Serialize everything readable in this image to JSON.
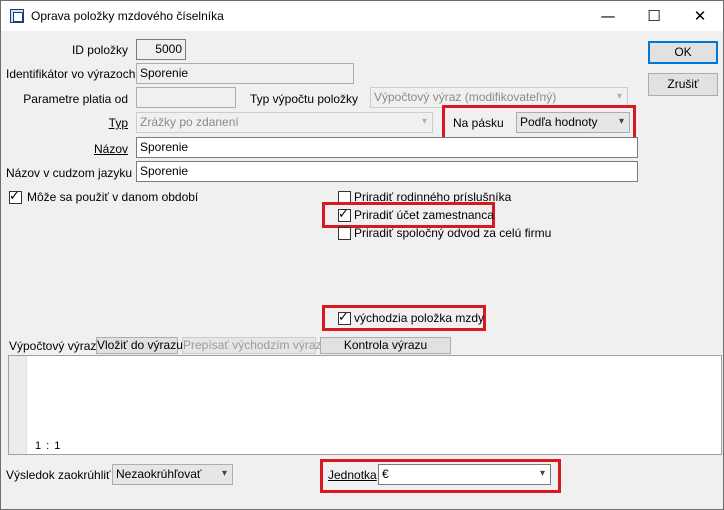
{
  "window": {
    "title": "Oprava položky mzdového číselníka"
  },
  "titlebar": {
    "minimize": "—",
    "maximize": "☐",
    "close": "✕"
  },
  "form": {
    "id_label": "ID položky",
    "id_value": "5000",
    "ident_label": "Identifikátor vo výrazoch",
    "ident_value": "Sporenie",
    "param_label": "Parametre platia od",
    "param_value": "",
    "calc_type_label": "Typ výpočtu položky",
    "calc_type_value": "Výpočtový výraz (modifikovateľný)",
    "type_label": "Typ",
    "type_value": "Zrážky po zdanení",
    "tape_label": "Na pásku",
    "tape_value": "Podľa hodnoty",
    "name_label": "Názov",
    "name_value": "Sporenie",
    "foreign_name_label": "Názov v cudzom jazyku",
    "foreign_name_value": "Sporenie"
  },
  "checkboxes": {
    "usable_period": {
      "label": "Môže sa použiť v danom období",
      "checked": true
    },
    "assign_family": {
      "label": "Priradiť rodinného príslušníka",
      "checked": false
    },
    "assign_account": {
      "label": "Priradiť účet zamestnanca",
      "checked": true
    },
    "assign_common": {
      "label": "Priradiť spoločný odvod za celú firmu",
      "checked": false
    },
    "default_item": {
      "label": "východzia položka mzdy",
      "checked": true
    }
  },
  "buttons": {
    "ok": "OK",
    "cancel": "Zrušiť"
  },
  "expression": {
    "label": "Výpočtový výraz:",
    "insert": "Vložiť do výrazu",
    "overwrite": "Prepísať východzím výrazom",
    "check": "Kontrola výrazu",
    "cursor_pos": "1 : 1"
  },
  "footer": {
    "rounding_label": "Výsledok zaokrúhliť",
    "rounding_value": "Nezaokrúhľovať",
    "unit_label": "Jednotka",
    "unit_value": "€"
  },
  "colors": {
    "highlight": "#d71920",
    "accent": "#0078d7"
  }
}
